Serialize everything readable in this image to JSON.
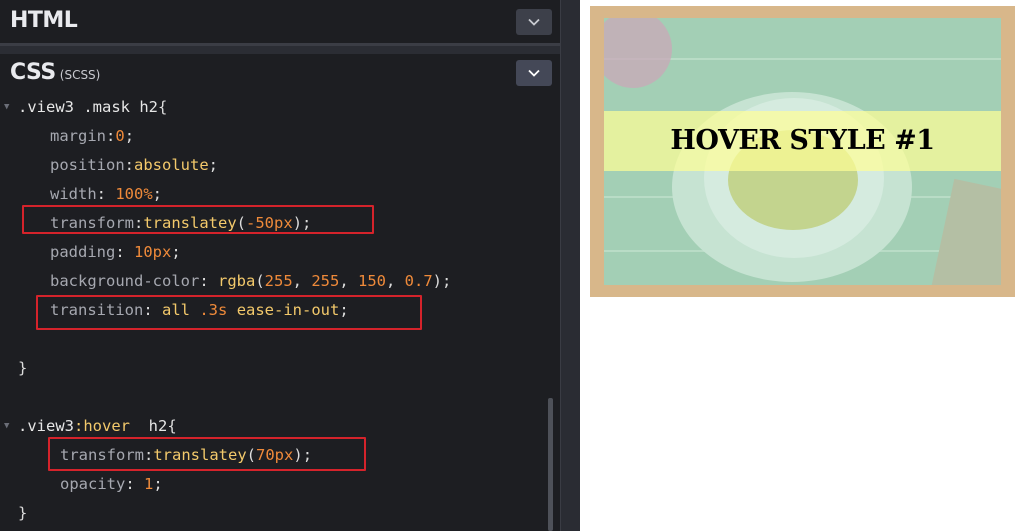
{
  "panes": {
    "html": {
      "title": "HTML"
    },
    "css": {
      "title": "CSS",
      "subtitle": "(SCSS)"
    }
  },
  "code": {
    "block1": {
      "selector": ".view3 .mask h2",
      "open": "{",
      "decls": [
        {
          "prop": "margin",
          "sep": ":",
          "value": "0",
          "vtype": "num",
          "end": ";"
        },
        {
          "prop": "position",
          "sep": ":",
          "value": "absolute",
          "vtype": "val",
          "end": ";"
        },
        {
          "prop": "width",
          "sep": ": ",
          "value": "100%",
          "vtype": "num",
          "end": ";"
        },
        {
          "prop": "transform",
          "sep": ":",
          "fn": "translatey",
          "arg": "-50px",
          "end": ";"
        },
        {
          "prop": "padding",
          "sep": ": ",
          "value": "10px",
          "vtype": "num",
          "end": ";"
        },
        {
          "prop": "background-color",
          "sep": ": ",
          "fn": "rgba",
          "args": [
            "255",
            "255",
            "150",
            "0.7"
          ],
          "end": ";"
        },
        {
          "prop": "transition",
          "sep": ": ",
          "value": "all",
          "value2": ".3s",
          "value3": "ease-in-out",
          "end": ";"
        }
      ],
      "close": "}"
    },
    "block2": {
      "selector_a": ".view3",
      "pseudo": ":hover",
      "selector_b": "  h2",
      "open": "{",
      "decls": [
        {
          "prop": "transform",
          "sep": ":",
          "fn": "translatey",
          "arg": "70px",
          "end": ";"
        },
        {
          "prop": "opacity",
          "sep": ": ",
          "value": "1",
          "end": ";"
        }
      ],
      "close": "}"
    }
  },
  "preview": {
    "heading": "HOVER STYLE #1"
  },
  "colors": {
    "editor_bg": "#1d1e22",
    "highlight_border": "#d5232b",
    "property": "#a6a8b0",
    "value": "#f3c96b",
    "number": "#ef8a3a",
    "frame": "#d8b78a",
    "mask": "rgba(255,255,150,0.7)"
  },
  "icons": [
    "chevron-down-icon",
    "fold-arrow-icon"
  ]
}
